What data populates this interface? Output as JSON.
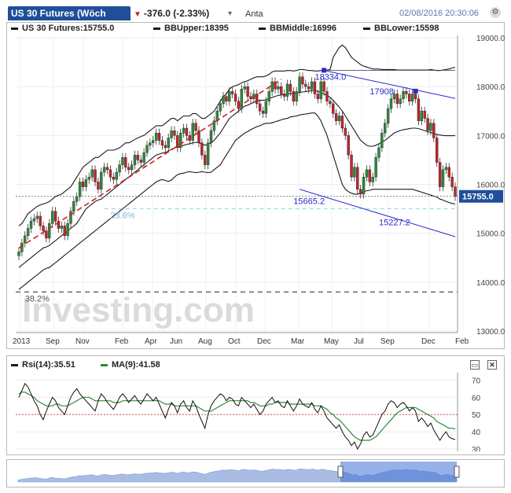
{
  "header": {
    "title": "US 30 Futures (Wöch",
    "change": "-376.0 (-2.33%)",
    "search_value": "Anta",
    "timestamp": "02/08/2016 20:30:06"
  },
  "legend": {
    "price": "US 30 Futures:15755.0",
    "bb_upper": "BBUpper:18395",
    "bb_middle": "BBMiddle:16996",
    "bb_lower": "BBLower:15598"
  },
  "rsi_legend": {
    "rsi": "Rsi(14):35.51",
    "ma": "MA(9):41.58"
  },
  "watermark": "Investing.com",
  "colors": {
    "brand": "#1f4e9a",
    "up_candle": "#2c8a3a",
    "down_candle": "#c0252b",
    "trendline": "#2a2ad0",
    "bb_line": "#1a1a1a",
    "rsi_ma": "#2c8a3a",
    "last_price_box": "#1f4e9a"
  },
  "chart_data": [
    {
      "type": "candlestick",
      "last_price_label": "15755.0",
      "y_axis": {
        "ticks": [
          "19000.0",
          "18000.0",
          "17000.0",
          "16000.0",
          "15000.0",
          "14000.0",
          "13000.0"
        ],
        "range": [
          13000,
          19000
        ]
      },
      "x_axis": {
        "labels": [
          "2013",
          "Sep",
          "Nov",
          "Feb",
          "Apr",
          "Jun",
          "Aug",
          "Oct",
          "Dec",
          "Mar",
          "May",
          "Jul",
          "Sep",
          "Dec",
          "Feb"
        ]
      },
      "annotations": [
        {
          "text": "18334.0",
          "value": 18334
        },
        {
          "text": "17908",
          "value": 17908
        },
        {
          "text": "15665.2",
          "value": 15665.2
        },
        {
          "text": "15227.2",
          "value": 15227.2
        },
        {
          "text": "23.6%",
          "value": 15500
        },
        {
          "text": "38.2%",
          "value": 13800
        }
      ],
      "grid": true,
      "series": [
        {
          "name": "US 30 Futures",
          "close": [
            14620,
            14800,
            14950,
            15100,
            15250,
            15300,
            15350,
            15150,
            15050,
            14900,
            15200,
            15450,
            15250,
            15100,
            15150,
            14950,
            15200,
            15450,
            15650,
            15750,
            16050,
            15950,
            16100,
            16150,
            16300,
            16050,
            15900,
            16250,
            16350,
            16300,
            16150,
            16100,
            16250,
            16400,
            16550,
            16350,
            16300,
            16400,
            16600,
            16500,
            16450,
            16650,
            16800,
            16850,
            16900,
            17050,
            16900,
            16800,
            16750,
            16950,
            17100,
            17000,
            16750,
            17050,
            17150,
            17000,
            16900,
            17250,
            17100,
            16850,
            16600,
            16400,
            16850,
            17100,
            17300,
            17500,
            17650,
            17800,
            17700,
            17900,
            17850,
            17700,
            17550,
            17950,
            18000,
            17800,
            17750,
            17850,
            17650,
            17500,
            17450,
            17700,
            17900,
            18100,
            17950,
            18000,
            17850,
            17800,
            18050,
            17900,
            17700,
            17900,
            18200,
            18050,
            18000,
            17950,
            18100,
            17850,
            17750,
            18100,
            17900,
            17700,
            17650,
            17450,
            17300,
            17400,
            17150,
            17000,
            16600,
            16150,
            16350,
            15900,
            15800,
            16150,
            16300,
            16050,
            16150,
            16550,
            16750,
            17050,
            17250,
            17550,
            17750,
            17850,
            17650,
            17750,
            17900,
            17850,
            17700,
            17850,
            17750,
            17300,
            17500,
            17350,
            17100,
            17250,
            16950,
            16450,
            15950,
            16300,
            16350,
            16150,
            15950,
            15755
          ]
        },
        {
          "name": "BBUpper",
          "values": [
            15150,
            15200,
            15300,
            15400,
            15450,
            15500,
            15550,
            15580,
            15600,
            15620,
            15650,
            15700,
            15750,
            15780,
            15800,
            15850,
            15900,
            15950,
            16050,
            16150,
            16250,
            16350,
            16400,
            16450,
            16500,
            16550,
            16550,
            16600,
            16650,
            16700,
            16700,
            16700,
            16720,
            16750,
            16800,
            16850,
            16850,
            16880,
            16920,
            16950,
            16980,
            17000,
            17050,
            17100,
            17150,
            17200,
            17200,
            17200,
            17250,
            17300,
            17350,
            17350,
            17300,
            17350,
            17400,
            17400,
            17400,
            17450,
            17450,
            17400,
            17350,
            17350,
            17400,
            17450,
            17500,
            17600,
            17700,
            17800,
            17850,
            17950,
            18000,
            18020,
            18040,
            18080,
            18100,
            18120,
            18150,
            18180,
            18200,
            18200,
            18200,
            18220,
            18250,
            18300,
            18320,
            18320,
            18320,
            18320,
            18330,
            18330,
            18320,
            18330,
            18350,
            18350,
            18340,
            18330,
            18330,
            18320,
            18320,
            18330,
            18330,
            18340,
            18350,
            18600,
            18700,
            18800,
            18850,
            18800,
            18700,
            18600,
            18550,
            18500,
            18450,
            18420,
            18400,
            18380,
            18360,
            18360,
            18360,
            18350,
            18350,
            18350,
            18350,
            18350,
            18340,
            18340,
            18340,
            18340,
            18340,
            18340,
            18340,
            18340,
            18340,
            18340,
            18340,
            18350,
            18340,
            18330,
            18330,
            18340,
            18350,
            18360,
            18380,
            18395
          ]
        },
        {
          "name": "BBMiddle",
          "values": [
            14300,
            14350,
            14400,
            14450,
            14500,
            14550,
            14600,
            14650,
            14700,
            14720,
            14750,
            14800,
            14850,
            14900,
            14950,
            15000,
            15050,
            15100,
            15150,
            15200,
            15300,
            15400,
            15500,
            15550,
            15600,
            15650,
            15680,
            15700,
            15750,
            15800,
            15850,
            15900,
            15950,
            16000,
            16050,
            16100,
            16150,
            16200,
            16250,
            16300,
            16350,
            16400,
            16450,
            16500,
            16550,
            16600,
            16620,
            16640,
            16650,
            16680,
            16720,
            16750,
            16760,
            16780,
            16800,
            16820,
            16830,
            16850,
            16860,
            16850,
            16830,
            16800,
            16820,
            16850,
            16900,
            16980,
            17050,
            17150,
            17250,
            17350,
            17400,
            17450,
            17500,
            17550,
            17600,
            17620,
            17650,
            17680,
            17700,
            17720,
            17720,
            17730,
            17750,
            17780,
            17800,
            17820,
            17830,
            17840,
            17850,
            17860,
            17860,
            17870,
            17880,
            17890,
            17900,
            17910,
            17920,
            17920,
            17900,
            17880,
            17850,
            17820,
            17780,
            17720,
            17650,
            17580,
            17500,
            17400,
            17300,
            17200,
            17100,
            17000,
            16900,
            16850,
            16800,
            16780,
            16780,
            16800,
            16830,
            16870,
            16900,
            16950,
            17000,
            17050,
            17080,
            17100,
            17120,
            17130,
            17140,
            17150,
            17150,
            17140,
            17120,
            17100,
            17080,
            17060,
            17040,
            17020,
            17010,
            17000,
            16995,
            16996,
            16996,
            16996
          ]
        },
        {
          "name": "BBLower",
          "values": [
            13850,
            13900,
            13950,
            14000,
            14050,
            14100,
            14150,
            14200,
            14250,
            14280,
            14300,
            14350,
            14400,
            14450,
            14500,
            14550,
            14600,
            14650,
            14700,
            14750,
            14800,
            14850,
            14900,
            14950,
            15000,
            15050,
            15100,
            15150,
            15200,
            15250,
            15300,
            15350,
            15400,
            15450,
            15500,
            15550,
            15600,
            15650,
            15700,
            15750,
            15800,
            15850,
            15900,
            15950,
            16000,
            16050,
            16080,
            16100,
            16080,
            16060,
            16090,
            16150,
            16200,
            16220,
            16230,
            16250,
            16260,
            16250,
            16240,
            16250,
            16260,
            16250,
            16240,
            16250,
            16300,
            16350,
            16400,
            16500,
            16600,
            16700,
            16800,
            16900,
            16950,
            17000,
            17050,
            17080,
            17120,
            17150,
            17180,
            17200,
            17230,
            17250,
            17250,
            17260,
            17280,
            17300,
            17320,
            17340,
            17350,
            17380,
            17390,
            17400,
            17420,
            17430,
            17440,
            17450,
            17460,
            17460,
            17400,
            17300,
            17150,
            17000,
            16800,
            16600,
            16400,
            16200,
            16000,
            15900,
            15850,
            15820,
            15800,
            15800,
            15820,
            15850,
            15870,
            15880,
            15900,
            15900,
            15900,
            15900,
            15900,
            15900,
            15900,
            15900,
            15900,
            15900,
            15900,
            15900,
            15900,
            15900,
            15880,
            15860,
            15840,
            15820,
            15800,
            15780,
            15760,
            15740,
            15700,
            15680,
            15650,
            15630,
            15610,
            15598
          ]
        }
      ]
    },
    {
      "type": "line",
      "y_axis": {
        "ticks": [
          "70",
          "60",
          "50",
          "40",
          "30"
        ],
        "range": [
          30,
          72
        ]
      },
      "reference_line": 50,
      "series": [
        {
          "name": "Rsi(14)",
          "values": [
            60,
            64,
            68,
            66,
            62,
            58,
            55,
            50,
            47,
            52,
            56,
            60,
            58,
            54,
            52,
            50,
            55,
            60,
            63,
            65,
            62,
            60,
            58,
            56,
            54,
            52,
            58,
            62,
            60,
            57,
            55,
            53,
            56,
            60,
            62,
            60,
            57,
            59,
            61,
            58,
            56,
            59,
            62,
            60,
            58,
            60,
            56,
            52,
            48,
            53,
            57,
            55,
            51,
            56,
            58,
            54,
            52,
            58,
            55,
            50,
            46,
            42,
            50,
            55,
            58,
            60,
            62,
            61,
            58,
            60,
            59,
            56,
            55,
            60,
            58,
            56,
            54,
            56,
            53,
            50,
            52,
            56,
            58,
            60,
            57,
            58,
            55,
            54,
            58,
            55,
            52,
            55,
            59,
            56,
            55,
            54,
            57,
            53,
            51,
            55,
            52,
            48,
            46,
            44,
            42,
            44,
            40,
            37,
            35,
            32,
            34,
            30,
            33,
            38,
            40,
            37,
            38,
            42,
            46,
            50,
            52,
            56,
            58,
            57,
            54,
            56,
            57,
            55,
            52,
            54,
            52,
            46,
            48,
            46,
            43,
            45,
            41,
            38,
            35,
            38,
            40,
            37,
            36,
            35.51
          ]
        },
        {
          "name": "MA(9)",
          "values": [
            62,
            63,
            63,
            62,
            61,
            60,
            58,
            57,
            56,
            55,
            55,
            55,
            56,
            56,
            55,
            55,
            55,
            56,
            57,
            58,
            59,
            60,
            60,
            60,
            59,
            58,
            58,
            58,
            58,
            58,
            58,
            57,
            57,
            57,
            58,
            58,
            58,
            58,
            58,
            58,
            58,
            58,
            58,
            58,
            58,
            58,
            58,
            57,
            56,
            56,
            56,
            55,
            55,
            55,
            55,
            55,
            55,
            55,
            55,
            54,
            53,
            52,
            52,
            52,
            53,
            54,
            55,
            56,
            57,
            58,
            58,
            58,
            58,
            58,
            58,
            58,
            57,
            57,
            56,
            55,
            55,
            55,
            56,
            56,
            57,
            57,
            57,
            57,
            57,
            56,
            56,
            56,
            56,
            56,
            56,
            56,
            56,
            55,
            55,
            55,
            54,
            53,
            51,
            50,
            48,
            47,
            45,
            43,
            41,
            39,
            37,
            36,
            35,
            35,
            35,
            35,
            36,
            37,
            39,
            41,
            43,
            45,
            47,
            49,
            51,
            52,
            53,
            54,
            54,
            54,
            54,
            53,
            52,
            51,
            50,
            49,
            48,
            46,
            45,
            44,
            43,
            42,
            42,
            41.58
          ]
        }
      ]
    }
  ]
}
